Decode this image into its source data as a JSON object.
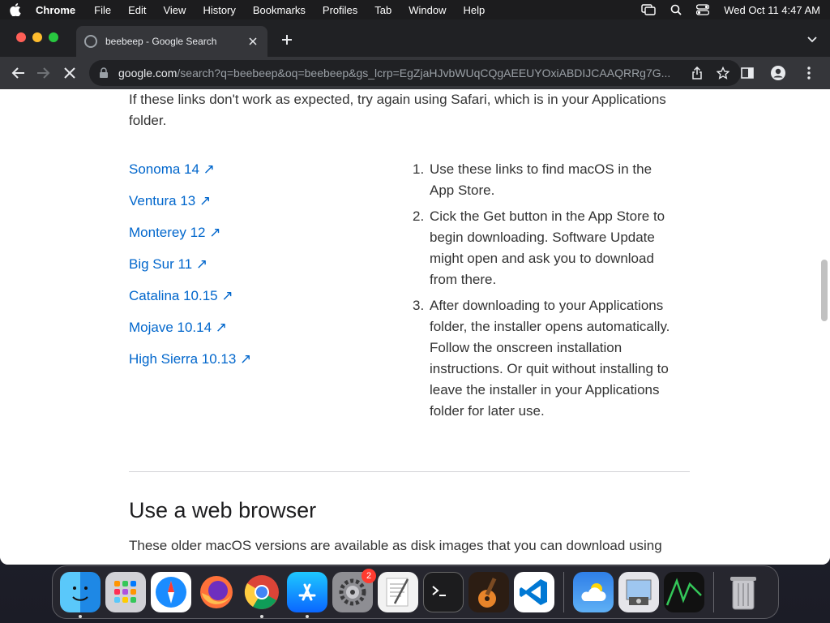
{
  "menubar": {
    "app_name": "Chrome",
    "items": [
      "File",
      "Edit",
      "View",
      "History",
      "Bookmarks",
      "Profiles",
      "Tab",
      "Window",
      "Help"
    ],
    "clock": "Wed Oct 11  4:47 AM"
  },
  "browser": {
    "tab_title": "beebeep - Google Search",
    "url_host": "google.com",
    "url_path": "/search?q=beebeep&oq=beebeep&gs_lcrp=EgZjaHJvbWUqCQgAEEUYOxiABDIJCAAQRRg7G..."
  },
  "page": {
    "intro": "If these links don't work as expected, try again using Safari, which is in your Applications folder.",
    "links": [
      "Sonoma 14 ↗",
      "Ventura 13 ↗",
      "Monterey 12 ↗",
      "Big Sur 11 ↗",
      "Catalina 10.15 ↗",
      "Mojave 10.14 ↗",
      "High Sierra 10.13 ↗"
    ],
    "steps": [
      {
        "num": "1.",
        "text": "Use these links to find macOS in the App Store."
      },
      {
        "num": "2.",
        "text": "Cick the Get button in the App Store to begin downloading. Software Update might open and ask you to download from there."
      },
      {
        "num": "3.",
        "text": "After downloading to your Applications folder, the installer opens automatically. Follow the onscreen installation instructions. Or quit without installing to leave the installer in your Applications folder for later use."
      }
    ],
    "section_title": "Use a web browser",
    "section_text": "These older macOS versions are available as disk images that you can download using"
  },
  "dock": {
    "apps": [
      "finder-icon",
      "launchpad-icon",
      "safari-icon",
      "firefox-icon",
      "chrome-icon",
      "app-store-icon",
      "system-settings-icon",
      "textedit-icon",
      "terminal-icon",
      "garageband-icon",
      "vscode-icon",
      "weather-icon",
      "preview-icon",
      "activity-monitor-icon",
      "trash-icon"
    ],
    "settings_badge": "2"
  }
}
